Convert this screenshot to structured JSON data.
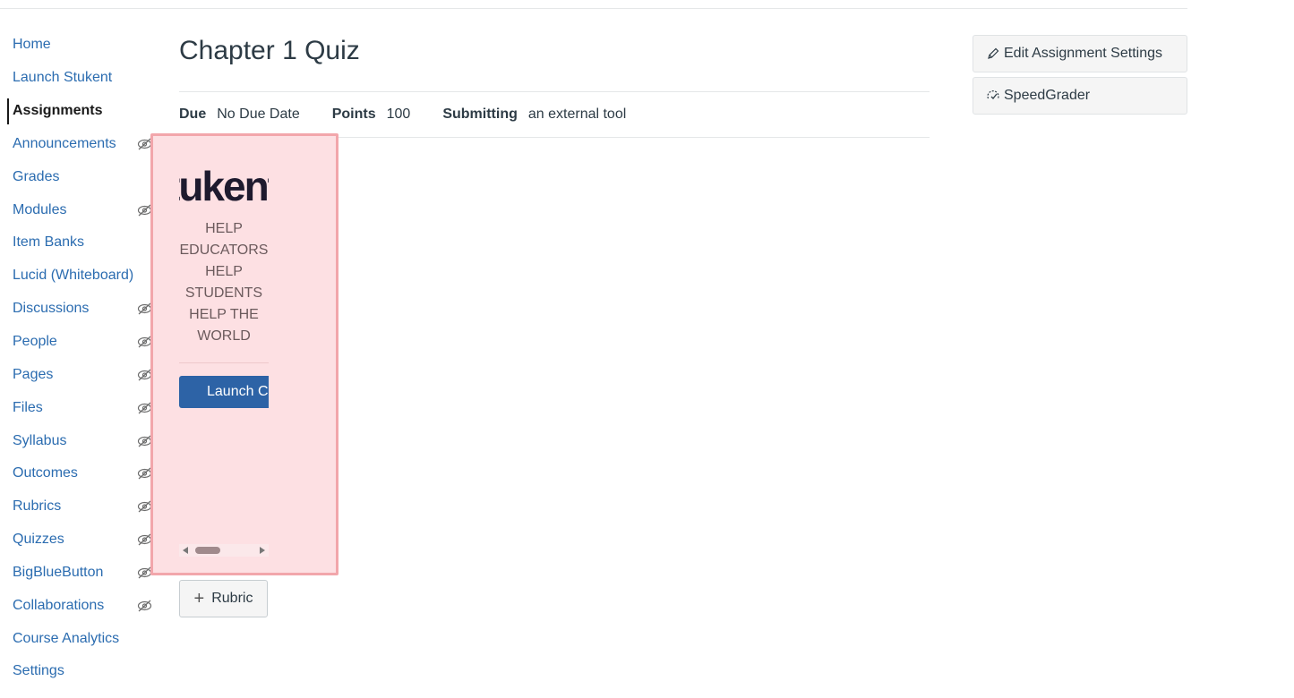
{
  "nav": {
    "items": [
      {
        "label": "Home",
        "hidden": false
      },
      {
        "label": "Launch Stukent",
        "hidden": false
      },
      {
        "label": "Assignments",
        "hidden": false,
        "active": true
      },
      {
        "label": "Announcements",
        "hidden": true
      },
      {
        "label": "Grades",
        "hidden": false
      },
      {
        "label": "Modules",
        "hidden": true
      },
      {
        "label": "Item Banks",
        "hidden": false
      },
      {
        "label": "Lucid (Whiteboard)",
        "hidden": false
      },
      {
        "label": "Discussions",
        "hidden": true
      },
      {
        "label": "People",
        "hidden": true
      },
      {
        "label": "Pages",
        "hidden": true
      },
      {
        "label": "Files",
        "hidden": true
      },
      {
        "label": "Syllabus",
        "hidden": true
      },
      {
        "label": "Outcomes",
        "hidden": true
      },
      {
        "label": "Rubrics",
        "hidden": true
      },
      {
        "label": "Quizzes",
        "hidden": true
      },
      {
        "label": "BigBlueButton",
        "hidden": true
      },
      {
        "label": "Collaborations",
        "hidden": true
      },
      {
        "label": "Course Analytics",
        "hidden": false
      },
      {
        "label": "Settings",
        "hidden": false
      }
    ]
  },
  "assignment": {
    "title": "Chapter 1 Quiz",
    "due_label": "Due",
    "due_value": "No Due Date",
    "points_label": "Points",
    "points_value": "100",
    "submitting_label": "Submitting",
    "submitting_value": "an external tool"
  },
  "tool": {
    "logo_text": "tukent",
    "tagline": "HELP EDUCATORS HELP STUDENTS HELP THE WORLD",
    "launch_label": "Launch C"
  },
  "rubric": {
    "label": "Rubric"
  },
  "sidebar": {
    "edit_label": "Edit Assignment Settings",
    "speedgrader_label": "SpeedGrader"
  },
  "colors": {
    "link": "#2b6cb0",
    "tool_bg": "#fde0e3",
    "tool_border": "#f2a6ab",
    "launch_bg": "#2d63a6"
  }
}
